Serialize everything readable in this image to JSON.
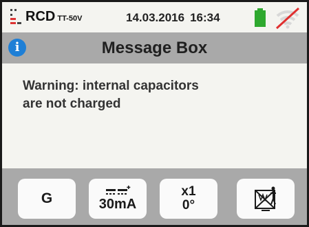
{
  "status": {
    "function_label": "RCD",
    "function_sub": "TT-50V",
    "date": "14.03.2016",
    "time": "16:34",
    "battery_icon": "battery-icon",
    "wireless_icon": "wireless-disabled-icon",
    "battery_color": "#2ea82e"
  },
  "titlebar": {
    "icon": "info-icon",
    "icon_glyph": "i",
    "title": "Message Box",
    "accent": "#1e7fd6"
  },
  "message": {
    "line1": "Warning: internal capacitors",
    "line2": "are not charged"
  },
  "buttons": {
    "mode_label": "G",
    "current_label": "30mA",
    "multiplier_label": "x1",
    "phase_label": "0°",
    "touch_voltage_icon": "touch-voltage-disabled-icon"
  }
}
